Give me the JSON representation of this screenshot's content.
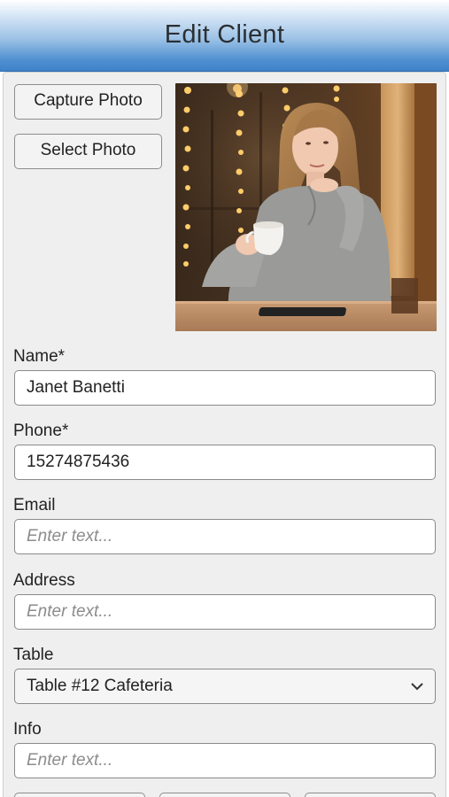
{
  "header": {
    "title": "Edit Client"
  },
  "photo_actions": {
    "capture_label": "Capture Photo",
    "select_label": "Select Photo"
  },
  "form": {
    "name": {
      "label": "Name*",
      "value": "Janet Banetti"
    },
    "phone": {
      "label": "Phone*",
      "value": "15274875436"
    },
    "email": {
      "label": "Email",
      "placeholder": "Enter text..."
    },
    "address": {
      "label": "Address",
      "placeholder": "Enter text..."
    },
    "table": {
      "label": "Table",
      "selected": "Table #12 Cafeteria"
    },
    "info": {
      "label": "Info",
      "placeholder": "Enter text..."
    }
  },
  "colors": {
    "header_gradient_top": "#ffffff",
    "header_gradient_bottom": "#3f82c8",
    "panel_background": "#efefef"
  },
  "icons": {
    "select_chevron": "chevron-down-icon"
  }
}
